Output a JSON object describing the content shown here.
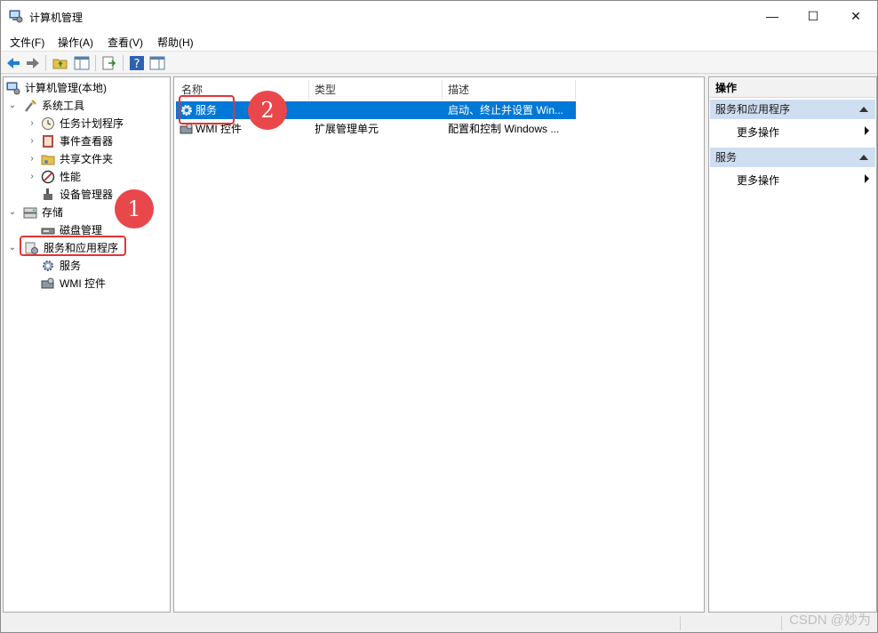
{
  "window": {
    "title": "计算机管理",
    "controls": {
      "minimize": "—",
      "maximize": "☐",
      "close": "✕"
    }
  },
  "menubar": {
    "items": [
      {
        "label": "文件(F)"
      },
      {
        "label": "操作(A)"
      },
      {
        "label": "查看(V)"
      },
      {
        "label": "帮助(H)"
      }
    ]
  },
  "toolbar": {
    "buttons": [
      "back-icon",
      "forward-icon",
      "up-folder-icon",
      "show-hide-tree-icon",
      "export-list-icon",
      "help-icon",
      "show-action-pane-icon"
    ]
  },
  "tree": {
    "root": "计算机管理(本地)",
    "items": [
      {
        "label": "系统工具",
        "icon": "tools-icon"
      },
      {
        "label": "任务计划程序",
        "icon": "clock-icon"
      },
      {
        "label": "事件查看器",
        "icon": "event-viewer-icon"
      },
      {
        "label": "共享文件夹",
        "icon": "shared-folder-icon"
      },
      {
        "label": "性能",
        "icon": "performance-icon"
      },
      {
        "label": "设备管理器",
        "icon": "device-manager-icon"
      },
      {
        "label": "存储",
        "icon": "storage-icon"
      },
      {
        "label": "磁盘管理",
        "icon": "disk-icon"
      },
      {
        "label": "服务和应用程序",
        "icon": "services-apps-icon"
      },
      {
        "label": "服务",
        "icon": "gear-icon"
      },
      {
        "label": "WMI 控件",
        "icon": "wmi-icon"
      }
    ]
  },
  "list": {
    "columns": [
      {
        "label": "名称"
      },
      {
        "label": "类型"
      },
      {
        "label": "描述"
      }
    ],
    "rows": [
      {
        "name": "服务",
        "type": "",
        "desc": "启动、终止并设置 Win..."
      },
      {
        "name": "WMI 控件",
        "type": "扩展管理单元",
        "desc": "配置和控制 Windows ..."
      }
    ]
  },
  "actions": {
    "title": "操作",
    "groups": [
      {
        "label": "服务和应用程序",
        "more": "更多操作"
      },
      {
        "label": "服务",
        "more": "更多操作"
      }
    ]
  },
  "annotations": {
    "badge1": "1",
    "badge2": "2"
  },
  "watermark": "CSDN @妙为",
  "colors": {
    "selection": "#0078d7",
    "annotation_red": "#e53333",
    "action_group_bg": "#cfdef0"
  }
}
